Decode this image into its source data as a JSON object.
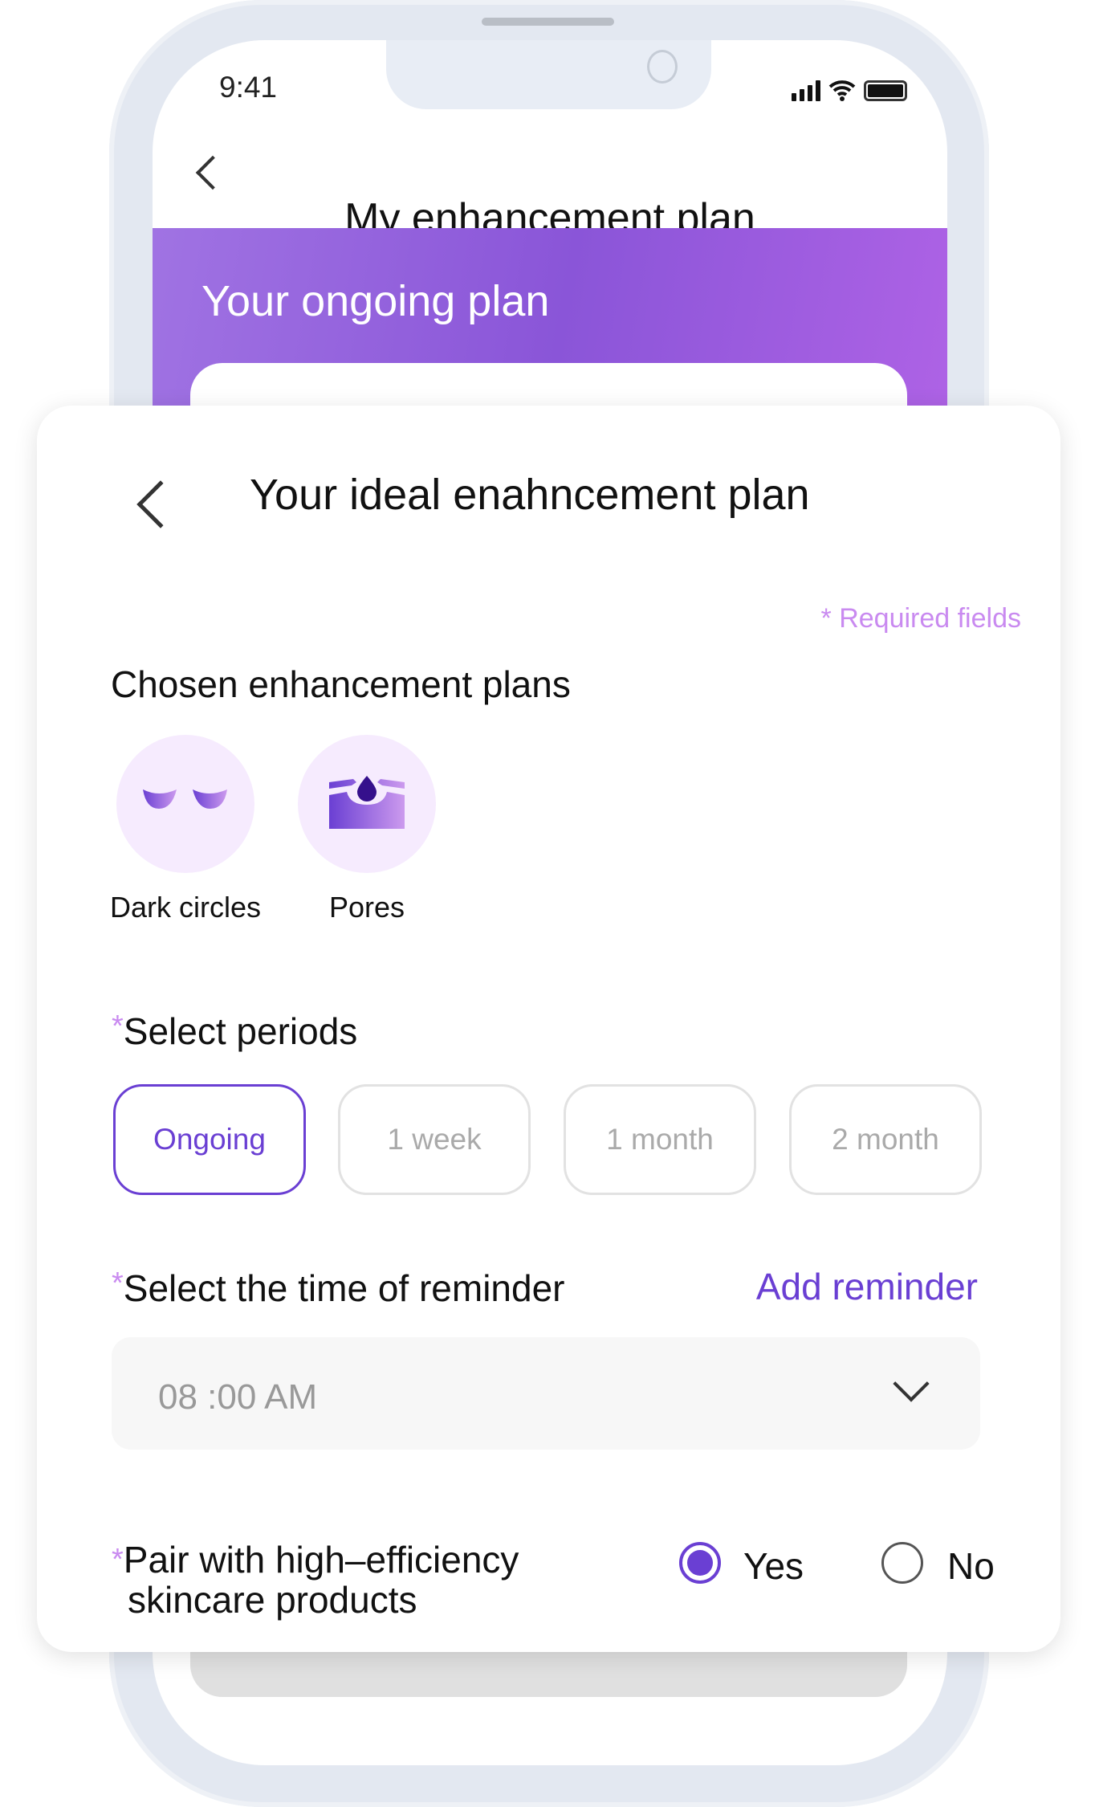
{
  "status_bar": {
    "time": "9:41"
  },
  "background_screen": {
    "title": "My enhancement plan",
    "banner_title": "Your ongoing plan"
  },
  "dialog": {
    "title": "Your ideal enahncement plan",
    "required_note": "*  Required fields",
    "chosen_heading": "Chosen enhancement plans",
    "plans": [
      {
        "label": "Dark circles",
        "icon": "closed-eyes-icon"
      },
      {
        "label": "Pores",
        "icon": "pore-drop-icon"
      }
    ],
    "periods_heading": "Select periods",
    "periods": [
      "Ongoing",
      "1 week",
      "1 month",
      "2 month"
    ],
    "selected_period": "Ongoing",
    "reminder_heading": "Select the time of reminder",
    "add_reminder": "Add reminder",
    "reminder_value": "08 :00 AM",
    "pair_heading_line1": "Pair with high–efficiency",
    "pair_heading_line2": "skincare products",
    "pair_options": [
      "Yes",
      "No"
    ],
    "pair_selected": "Yes",
    "required_mark": "*"
  },
  "colors": {
    "accent": "#6a3fd3",
    "required": "#c98af0",
    "banner": "#8a55d8",
    "chip_bg": "#f6ebfe"
  }
}
